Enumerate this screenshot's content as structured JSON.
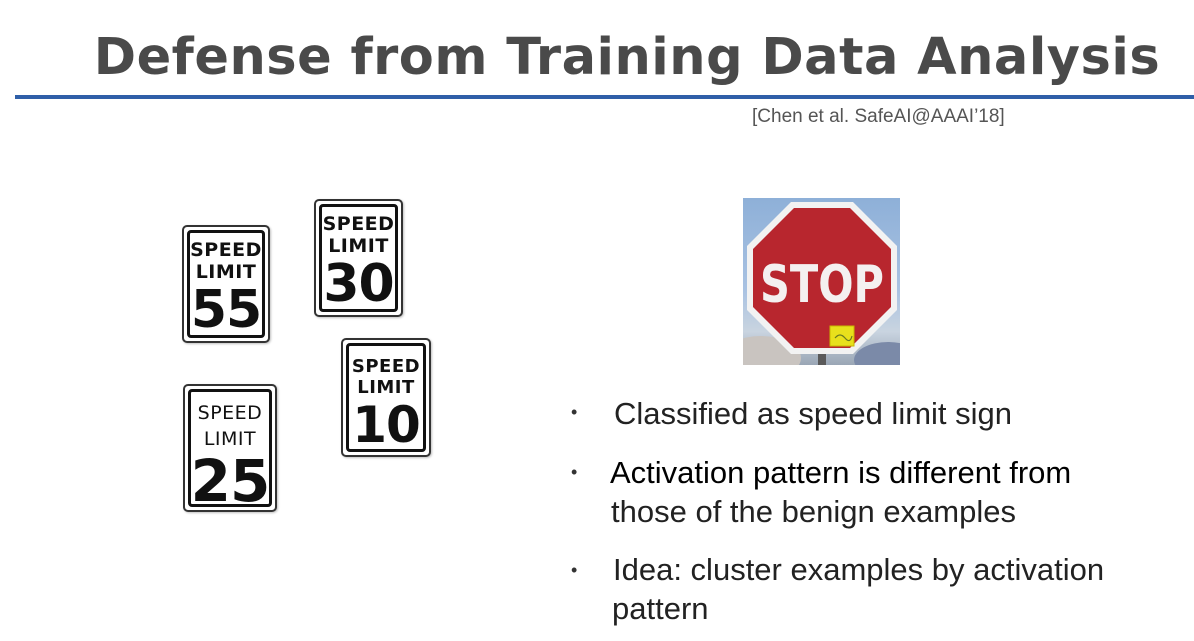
{
  "slide": {
    "title": "Defense from Training Data Analysis",
    "citation": "[Chen et al. SafeAI@AAAI’18]"
  },
  "signs": [
    {
      "word1": "SPEED",
      "word2": "LIMIT",
      "number": "55"
    },
    {
      "word1": "SPEED",
      "word2": "LIMIT",
      "number": "30"
    },
    {
      "word1": "SPEED",
      "word2": "LIMIT",
      "number": "10"
    },
    {
      "word1": "SPEED",
      "word2": "LIMIT",
      "number": "25"
    }
  ],
  "stop_sign": {
    "text": "STOP",
    "colors": {
      "sign": "#b8262e",
      "trigger": "#e8e01c",
      "sky": "#9bb8dc"
    }
  },
  "bullets": [
    {
      "marker": "•",
      "text": "Classified as speed limit sign"
    },
    {
      "marker": "•",
      "line1": "Activation pattern is different from",
      "line2": "those of the benign examples"
    },
    {
      "marker": "•",
      "line1": "Idea: cluster examples by activation",
      "line2": "pattern"
    }
  ],
  "colors": {
    "title": "#4a4a4a",
    "rule": "#2f5fa8",
    "text": "#222222"
  }
}
